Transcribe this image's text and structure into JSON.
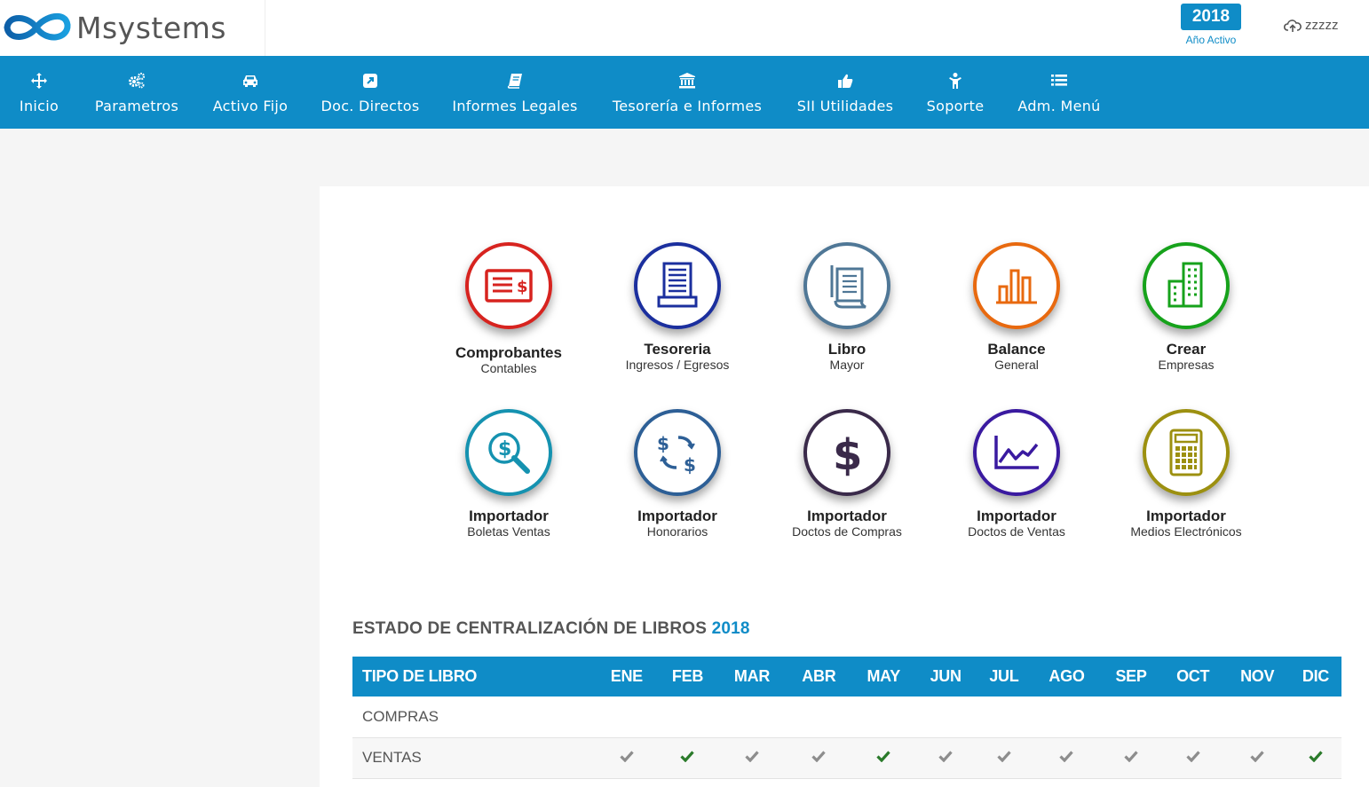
{
  "brand": {
    "name": "Msystems",
    "color": "#0f8cc7"
  },
  "header": {
    "year": "2018",
    "year_caption": "Año Activo",
    "user": "zzzzz"
  },
  "nav": [
    {
      "label": "Inicio",
      "icon": "move-icon"
    },
    {
      "label": "Parametros",
      "icon": "gears-icon"
    },
    {
      "label": "Activo Fijo",
      "icon": "car-icon"
    },
    {
      "label": "Doc. Directos",
      "icon": "external-link-icon"
    },
    {
      "label": "Informes Legales",
      "icon": "book-icon"
    },
    {
      "label": "Tesorería e Informes",
      "icon": "bank-icon"
    },
    {
      "label": "SII Utilidades",
      "icon": "thumbs-up-icon"
    },
    {
      "label": "Soporte",
      "icon": "person-icon"
    },
    {
      "label": "Adm. Menú",
      "icon": "list-icon"
    }
  ],
  "tiles": [
    {
      "title": "Comprobantes",
      "subtitle": "Contables",
      "icon": "voucher-icon",
      "color": "#d7231f"
    },
    {
      "title": "Tesoreria",
      "subtitle": "Ingresos / Egresos",
      "icon": "document-icon",
      "color": "#1b2f9e"
    },
    {
      "title": "Libro",
      "subtitle": "Mayor",
      "icon": "ledger-icon",
      "color": "#4f7796"
    },
    {
      "title": "Balance",
      "subtitle": "General",
      "icon": "bar-chart-icon",
      "color": "#e8690f"
    },
    {
      "title": "Crear",
      "subtitle": "Empresas",
      "icon": "buildings-icon",
      "color": "#16a21b"
    },
    {
      "title": "Importador",
      "subtitle": "Boletas Ventas",
      "icon": "search-dollar-icon",
      "color": "#1592b0"
    },
    {
      "title": "Importador",
      "subtitle": "Honorarios",
      "icon": "exchange-dollar-icon",
      "color": "#2d5f96"
    },
    {
      "title": "Importador",
      "subtitle": "Doctos de Compras",
      "icon": "dollar-icon",
      "color": "#3a2a4a"
    },
    {
      "title": "Importador",
      "subtitle": "Doctos de Ventas",
      "icon": "line-chart-icon",
      "color": "#3a1aa0"
    },
    {
      "title": "Importador",
      "subtitle": "Medios Electrónicos",
      "icon": "calculator-icon",
      "color": "#9c9010"
    }
  ],
  "status_section": {
    "title": "ESTADO DE CENTRALIZACIÓN DE LIBROS",
    "year": "2018",
    "first_header": "TIPO DE LIBRO",
    "months": [
      "ENE",
      "FEB",
      "MAR",
      "ABR",
      "MAY",
      "JUN",
      "JUL",
      "AGO",
      "SEP",
      "OCT",
      "NOV",
      "DIC"
    ],
    "rows": [
      {
        "name": "COMPRAS",
        "marks": [
          "",
          "",
          "",
          "",
          "",
          "",
          "",
          "",
          "",
          "",
          "",
          ""
        ]
      },
      {
        "name": "VENTAS",
        "marks": [
          "grey",
          "green",
          "grey",
          "grey",
          "green",
          "grey",
          "grey",
          "grey",
          "grey",
          "grey",
          "grey",
          "green"
        ]
      }
    ],
    "check_colors": {
      "grey": "#8d8d8d",
      "green": "#2a7a2a"
    }
  }
}
